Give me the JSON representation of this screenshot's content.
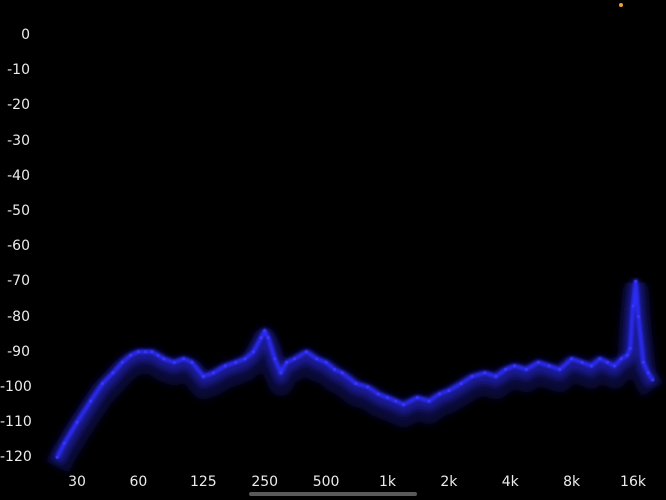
{
  "chart_data": {
    "type": "area",
    "title": "",
    "xlabel": "",
    "ylabel": "",
    "x_scale": "log",
    "xlim": [
      22,
      21000
    ],
    "ylim": [
      -125,
      5
    ],
    "grid": false,
    "legend": "none",
    "y_ticks": [
      "0",
      "-10",
      "-20",
      "-30",
      "-40",
      "-50",
      "-60",
      "-70",
      "-80",
      "-90",
      "-100",
      "-110",
      "-120"
    ],
    "y_tick_values": [
      0,
      -10,
      -20,
      -30,
      -40,
      -50,
      -60,
      -70,
      -80,
      -90,
      -100,
      -110,
      -120
    ],
    "x_ticks": [
      "30",
      "60",
      "125",
      "250",
      "500",
      "1k",
      "2k",
      "4k",
      "8k",
      "16k"
    ],
    "x_tick_values": [
      30,
      60,
      125,
      250,
      500,
      1000,
      2000,
      4000,
      8000,
      16000
    ],
    "series": [
      {
        "x": [
          24,
          26,
          30,
          35,
          40,
          45,
          50,
          55,
          60,
          65,
          70,
          75,
          80,
          90,
          100,
          110,
          125,
          140,
          160,
          180,
          200,
          220,
          240,
          250,
          260,
          280,
          300,
          320,
          350,
          400,
          450,
          500,
          550,
          600,
          700,
          800,
          900,
          1000,
          1100,
          1200,
          1400,
          1600,
          1800,
          2000,
          2300,
          2600,
          3000,
          3400,
          3800,
          4200,
          4800,
          5500,
          6200,
          7000,
          8000,
          9000,
          10000,
          11000,
          12000,
          13000,
          14000,
          15000,
          15500,
          16000,
          16500,
          17000,
          18000,
          19000,
          20000
        ],
        "y": [
          -120,
          -116,
          -110,
          -104,
          -99,
          -96,
          -93,
          -91,
          -90,
          -90,
          -90,
          -91,
          -92,
          -93,
          -92,
          -93,
          -97,
          -96,
          -94,
          -93,
          -92,
          -90,
          -86,
          -84,
          -86,
          -92,
          -96,
          -93,
          -92,
          -90,
          -92,
          -93,
          -95,
          -96,
          -99,
          -100,
          -102,
          -103,
          -104,
          -105,
          -103,
          -104,
          -102,
          -101,
          -99,
          -97,
          -96,
          -97,
          -95,
          -94,
          -95,
          -93,
          -94,
          -95,
          -92,
          -93,
          -94,
          -92,
          -93,
          -94,
          -92,
          -91,
          -89,
          -77,
          -70,
          -80,
          -93,
          -96,
          -98
        ]
      }
    ],
    "colors": {
      "spectrum_core": "#2c2cff",
      "spectrum_glow": "#1414a0"
    }
  }
}
